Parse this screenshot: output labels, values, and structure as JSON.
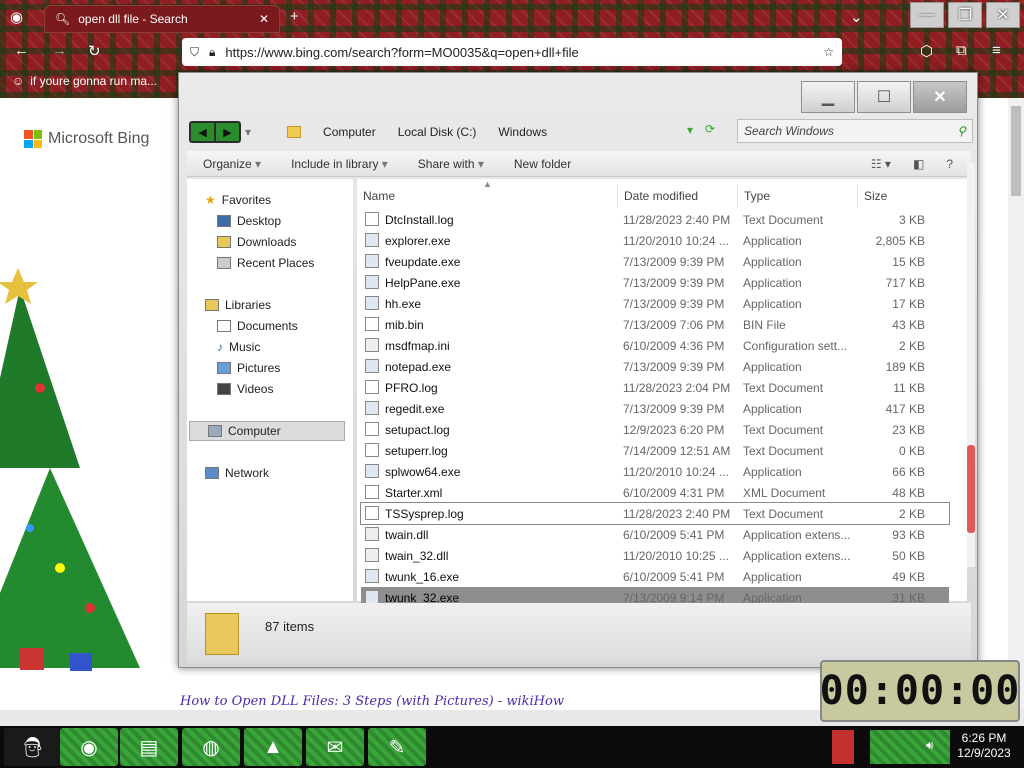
{
  "browser": {
    "tab_title": "open dll file - Search",
    "url": "https://www.bing.com/search?form=MO0035&q=open+dll+file",
    "bookmark_label": "if youre gonna run ma...",
    "icons": {
      "tab_icon": "search-icon",
      "new_tab": "plus-icon",
      "close_tab": "close-icon",
      "back": "arrow-left-icon",
      "forward": "arrow-right-icon",
      "reload": "reload-icon",
      "star": "star-icon",
      "menu": "hamburger-icon"
    },
    "new_tab_glyph": "+",
    "close_glyph": "✕"
  },
  "page": {
    "bing_logo": "Microsoft Bing",
    "result_link": "How to Open DLL Files: 3 Steps (with Pictures) - wikiHow"
  },
  "explorer": {
    "breadcrumbs": [
      "Computer",
      "Local Disk (C:)",
      "Windows"
    ],
    "search_placeholder": "Search Windows",
    "toolbar": {
      "organize": "Organize",
      "include": "Include in library",
      "share": "Share with",
      "new_folder": "New folder"
    },
    "nav": {
      "favorites": "Favorites",
      "desktop": "Desktop",
      "downloads": "Downloads",
      "recent": "Recent Places",
      "libraries": "Libraries",
      "documents": "Documents",
      "music": "Music",
      "pictures": "Pictures",
      "videos": "Videos",
      "computer": "Computer",
      "network": "Network"
    },
    "columns": {
      "name": "Name",
      "date": "Date modified",
      "type": "Type",
      "size": "Size"
    },
    "files": [
      {
        "name": "DtcInstall.log",
        "date": "11/28/2023 2:40 PM",
        "type": "Text Document",
        "size": "3 KB"
      },
      {
        "name": "explorer.exe",
        "date": "11/20/2010 10:24 ...",
        "type": "Application",
        "size": "2,805 KB"
      },
      {
        "name": "fveupdate.exe",
        "date": "7/13/2009 9:39 PM",
        "type": "Application",
        "size": "15 KB"
      },
      {
        "name": "HelpPane.exe",
        "date": "7/13/2009 9:39 PM",
        "type": "Application",
        "size": "717 KB"
      },
      {
        "name": "hh.exe",
        "date": "7/13/2009 9:39 PM",
        "type": "Application",
        "size": "17 KB"
      },
      {
        "name": "mib.bin",
        "date": "7/13/2009 7:06 PM",
        "type": "BIN File",
        "size": "43 KB"
      },
      {
        "name": "msdfmap.ini",
        "date": "6/10/2009 4:36 PM",
        "type": "Configuration sett...",
        "size": "2 KB"
      },
      {
        "name": "notepad.exe",
        "date": "7/13/2009 9:39 PM",
        "type": "Application",
        "size": "189 KB"
      },
      {
        "name": "PFRO.log",
        "date": "11/28/2023 2:04 PM",
        "type": "Text Document",
        "size": "11 KB"
      },
      {
        "name": "regedit.exe",
        "date": "7/13/2009 9:39 PM",
        "type": "Application",
        "size": "417 KB"
      },
      {
        "name": "setupact.log",
        "date": "12/9/2023 6:20 PM",
        "type": "Text Document",
        "size": "23 KB"
      },
      {
        "name": "setuperr.log",
        "date": "7/14/2009 12:51 AM",
        "type": "Text Document",
        "size": "0 KB"
      },
      {
        "name": "splwow64.exe",
        "date": "11/20/2010 10:24 ...",
        "type": "Application",
        "size": "66 KB"
      },
      {
        "name": "Starter.xml",
        "date": "6/10/2009 4:31 PM",
        "type": "XML Document",
        "size": "48 KB"
      },
      {
        "name": "TSSysprep.log",
        "date": "11/28/2023 2:40 PM",
        "type": "Text Document",
        "size": "2 KB"
      },
      {
        "name": "twain.dll",
        "date": "6/10/2009 5:41 PM",
        "type": "Application extens...",
        "size": "93 KB"
      },
      {
        "name": "twain_32.dll",
        "date": "11/20/2010 10:25 ...",
        "type": "Application extens...",
        "size": "50 KB"
      },
      {
        "name": "twunk_16.exe",
        "date": "6/10/2009 5:41 PM",
        "type": "Application",
        "size": "49 KB"
      },
      {
        "name": "twunk_32.exe",
        "date": "7/13/2009 9:14 PM",
        "type": "Application",
        "size": "31 KB"
      }
    ],
    "item_count": "87 items"
  },
  "clock_widget": {
    "display": "00:00:00"
  },
  "taskbar": {
    "time": "6:26 PM",
    "date": "12/9/2023"
  }
}
